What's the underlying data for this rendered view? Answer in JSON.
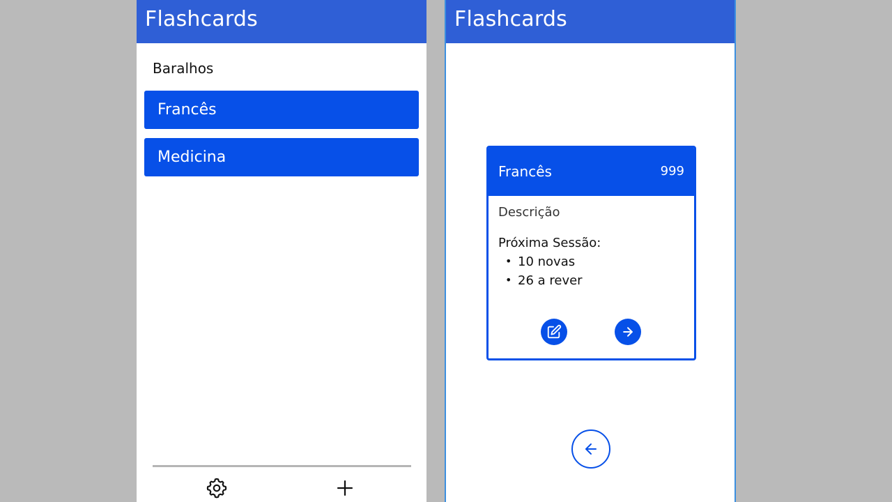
{
  "left_screen": {
    "app_title": "Flashcards",
    "section_heading": "Baralhos",
    "decks": [
      {
        "label": "Francês"
      },
      {
        "label": "Medicina"
      }
    ],
    "bottom_bar": {
      "settings_icon": "gear-icon",
      "add_icon": "plus-icon"
    }
  },
  "right_screen": {
    "app_title": "Flashcards",
    "deck_card": {
      "title": "Francês",
      "count": "999",
      "description": "Descrição",
      "next_session_label": "Próxima Sessão:",
      "items": [
        "10 novas",
        "26 a rever"
      ],
      "edit_icon": "edit-icon",
      "start_icon": "arrow-right-icon"
    },
    "back_icon": "arrow-left-icon"
  },
  "colors": {
    "appbar": "#2f5fd6",
    "primary": "#0750e8",
    "background": "#bababa",
    "divider": "#b5b5b5",
    "screen_border": "#3b8fe0"
  }
}
